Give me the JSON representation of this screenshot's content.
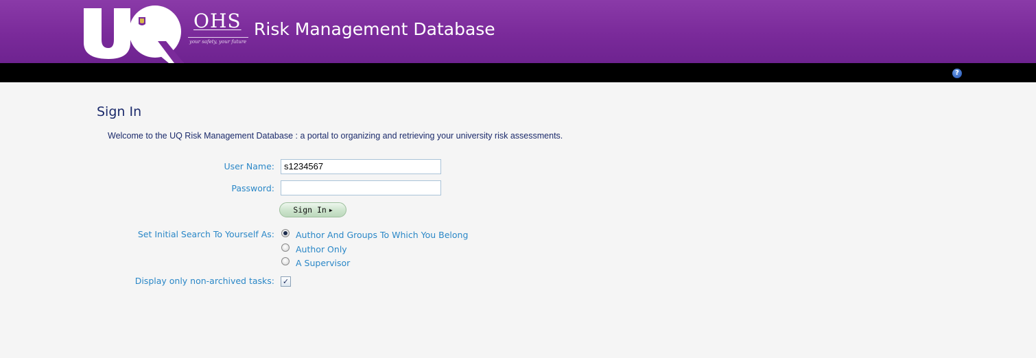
{
  "header": {
    "app_title": "Risk Management Database",
    "ohs_logo_text": "OHS",
    "ohs_tagline": "your safety, your future",
    "uq_logo_text": "UQ",
    "brand_color": "#7a2a9a"
  },
  "toolbar": {
    "help_icon": "help-icon",
    "help_glyph": "?"
  },
  "signin": {
    "title": "Sign In",
    "welcome": "Welcome to the UQ Risk Management Database : a portal to organizing and retrieving your university risk assessments.",
    "username_label": "User Name:",
    "username_value": "s1234567",
    "password_label": "Password:",
    "password_value": "",
    "button_label": "Sign In",
    "search_label": "Set Initial Search To Yourself As:",
    "search_options": [
      {
        "label": "Author And Groups To Which You Belong",
        "checked": true
      },
      {
        "label": "Author Only",
        "checked": false
      },
      {
        "label": "A Supervisor",
        "checked": false
      }
    ],
    "archived_label": "Display only non-archived tasks:",
    "archived_checked": true
  }
}
